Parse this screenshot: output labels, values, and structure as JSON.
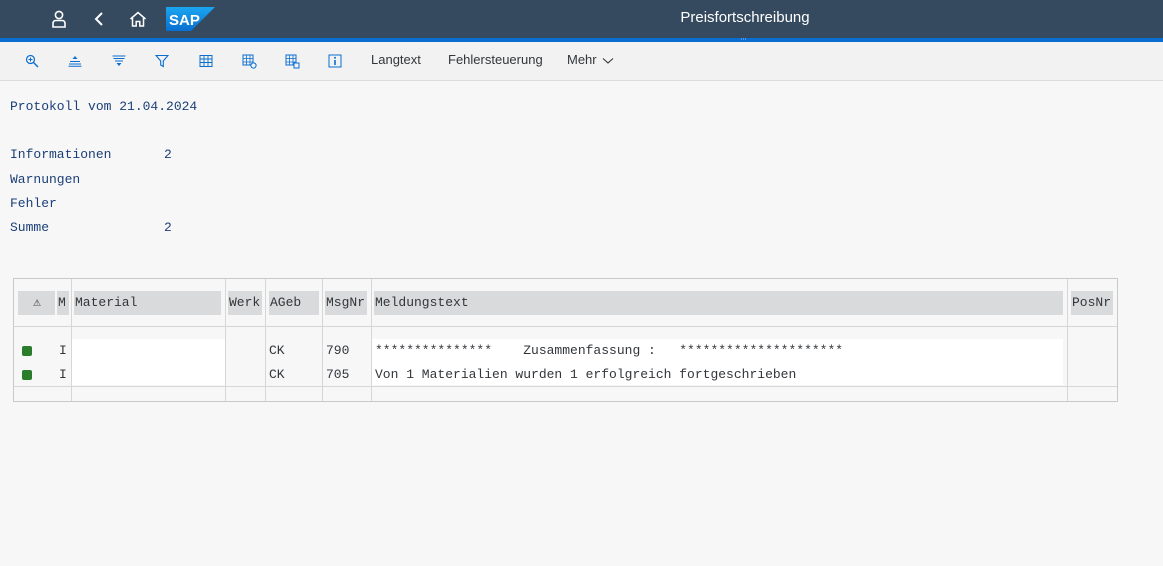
{
  "shell": {
    "title": "Preisfortschreibung",
    "logo": "SAP",
    "icons": [
      "user-icon",
      "back-icon",
      "home-icon"
    ]
  },
  "toolbar": {
    "icons": [
      "zoom-icon",
      "sort-ascending-icon",
      "sort-descending-icon",
      "filter-icon",
      "table-icon",
      "table-settings-icon",
      "table-export-icon",
      "info-icon"
    ],
    "langtext": "Langtext",
    "fehlersteuerung": "Fehlersteuerung",
    "mehr": "Mehr"
  },
  "protocol": {
    "title": "Protokoll vom 21.04.2024",
    "stats": [
      {
        "label": "Informationen",
        "value": "2"
      },
      {
        "label": "Warnungen",
        "value": ""
      },
      {
        "label": "Fehler",
        "value": ""
      },
      {
        "label": "Summe",
        "value": "2"
      }
    ]
  },
  "table": {
    "headers": {
      "status": "⚠",
      "m": "M",
      "material": "Material",
      "werk": "Werk",
      "ageb": "AGeb",
      "msgnr": "MsgNr",
      "meldungstext": "Meldungstext",
      "posnr": "PosNr"
    },
    "rows": [
      {
        "status": "green",
        "m": "I",
        "material": "",
        "werk": "",
        "ageb": "CK",
        "msgnr": "790",
        "text": "***************    Zusammenfassung :   *********************",
        "posnr": ""
      },
      {
        "status": "green",
        "m": "I",
        "material": "",
        "werk": "",
        "ageb": "CK",
        "msgnr": "705",
        "text": "Von 1 Materialien wurden 1 erfolgreich fortgeschrieben",
        "posnr": ""
      }
    ]
  },
  "colors": {
    "shell": "#354a5f",
    "accent": "#0a6ed1",
    "text_blue": "#1b3f78",
    "led_green": "#2b7d2b"
  }
}
